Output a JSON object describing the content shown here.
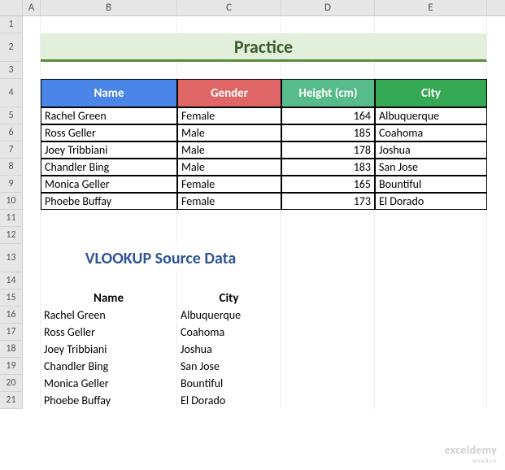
{
  "columns": [
    "",
    "A",
    "B",
    "C",
    "D",
    "E"
  ],
  "title_banner": "Practice",
  "table": {
    "headers": [
      "Name",
      "Gender",
      "Height (cm)",
      "City"
    ],
    "rows": [
      {
        "name": "Rachel Green",
        "gender": "Female",
        "height": "164",
        "city": "Albuquerque"
      },
      {
        "name": "Ross Geller",
        "gender": "Male",
        "height": "185",
        "city": "Coahoma"
      },
      {
        "name": "Joey Tribbiani",
        "gender": "Male",
        "height": "178",
        "city": "Joshua"
      },
      {
        "name": "Chandler Bing",
        "gender": "Male",
        "height": "183",
        "city": "San Jose"
      },
      {
        "name": "Monica Geller",
        "gender": "Female",
        "height": "165",
        "city": "Bountiful"
      },
      {
        "name": "Phoebe Buffay",
        "gender": "Female",
        "height": "173",
        "city": "El Dorado"
      }
    ]
  },
  "source": {
    "title": "VLOOKUP Source Data",
    "headers": [
      "Name",
      "City"
    ],
    "rows": [
      {
        "name": "Rachel Green",
        "city": "Albuquerque"
      },
      {
        "name": "Ross Geller",
        "city": "Coahoma"
      },
      {
        "name": "Joey Tribbiani",
        "city": "Joshua"
      },
      {
        "name": "Chandler Bing",
        "city": "San Jose"
      },
      {
        "name": "Monica Geller",
        "city": "Bountiful"
      },
      {
        "name": "Phoebe Buffay",
        "city": "El Dorado"
      }
    ]
  },
  "watermark": {
    "main": "exceldemy",
    "sub": "wsxdsn"
  },
  "row_numbers": [
    "1",
    "2",
    "3",
    "4",
    "5",
    "6",
    "7",
    "8",
    "9",
    "10",
    "11",
    "12",
    "13",
    "14",
    "15",
    "16",
    "17",
    "18",
    "19",
    "20",
    "21"
  ]
}
